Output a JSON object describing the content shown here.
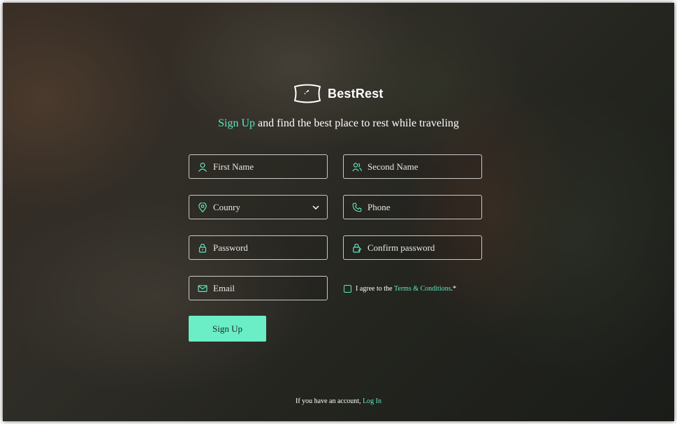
{
  "brand": {
    "name": "BestRest",
    "logo_icon": "pillow-icon",
    "accent_color": "#5ee6bf"
  },
  "headline": {
    "accent": "Sign Up",
    "rest": " and find the best place to rest while traveling"
  },
  "form": {
    "first_name": {
      "placeholder": "First Name",
      "icon": "user-icon"
    },
    "second_name": {
      "placeholder": "Second Name",
      "icon": "users-icon"
    },
    "country": {
      "selected": "Counry",
      "icon": "location-pin-icon"
    },
    "phone": {
      "placeholder": "Phone",
      "icon": "phone-icon"
    },
    "password": {
      "placeholder": "Password",
      "icon": "lock-icon"
    },
    "confirm_password": {
      "placeholder": "Confirm password",
      "icon": "lock-check-icon"
    },
    "email": {
      "placeholder": "Email",
      "icon": "mail-icon"
    },
    "agree": {
      "prefix": "I agree to the ",
      "link": "Terms & Conditions",
      "suffix": ".*",
      "checked": false
    },
    "submit_label": "Sign Up"
  },
  "footer": {
    "text": "If you have an account, ",
    "link": "Log In"
  }
}
